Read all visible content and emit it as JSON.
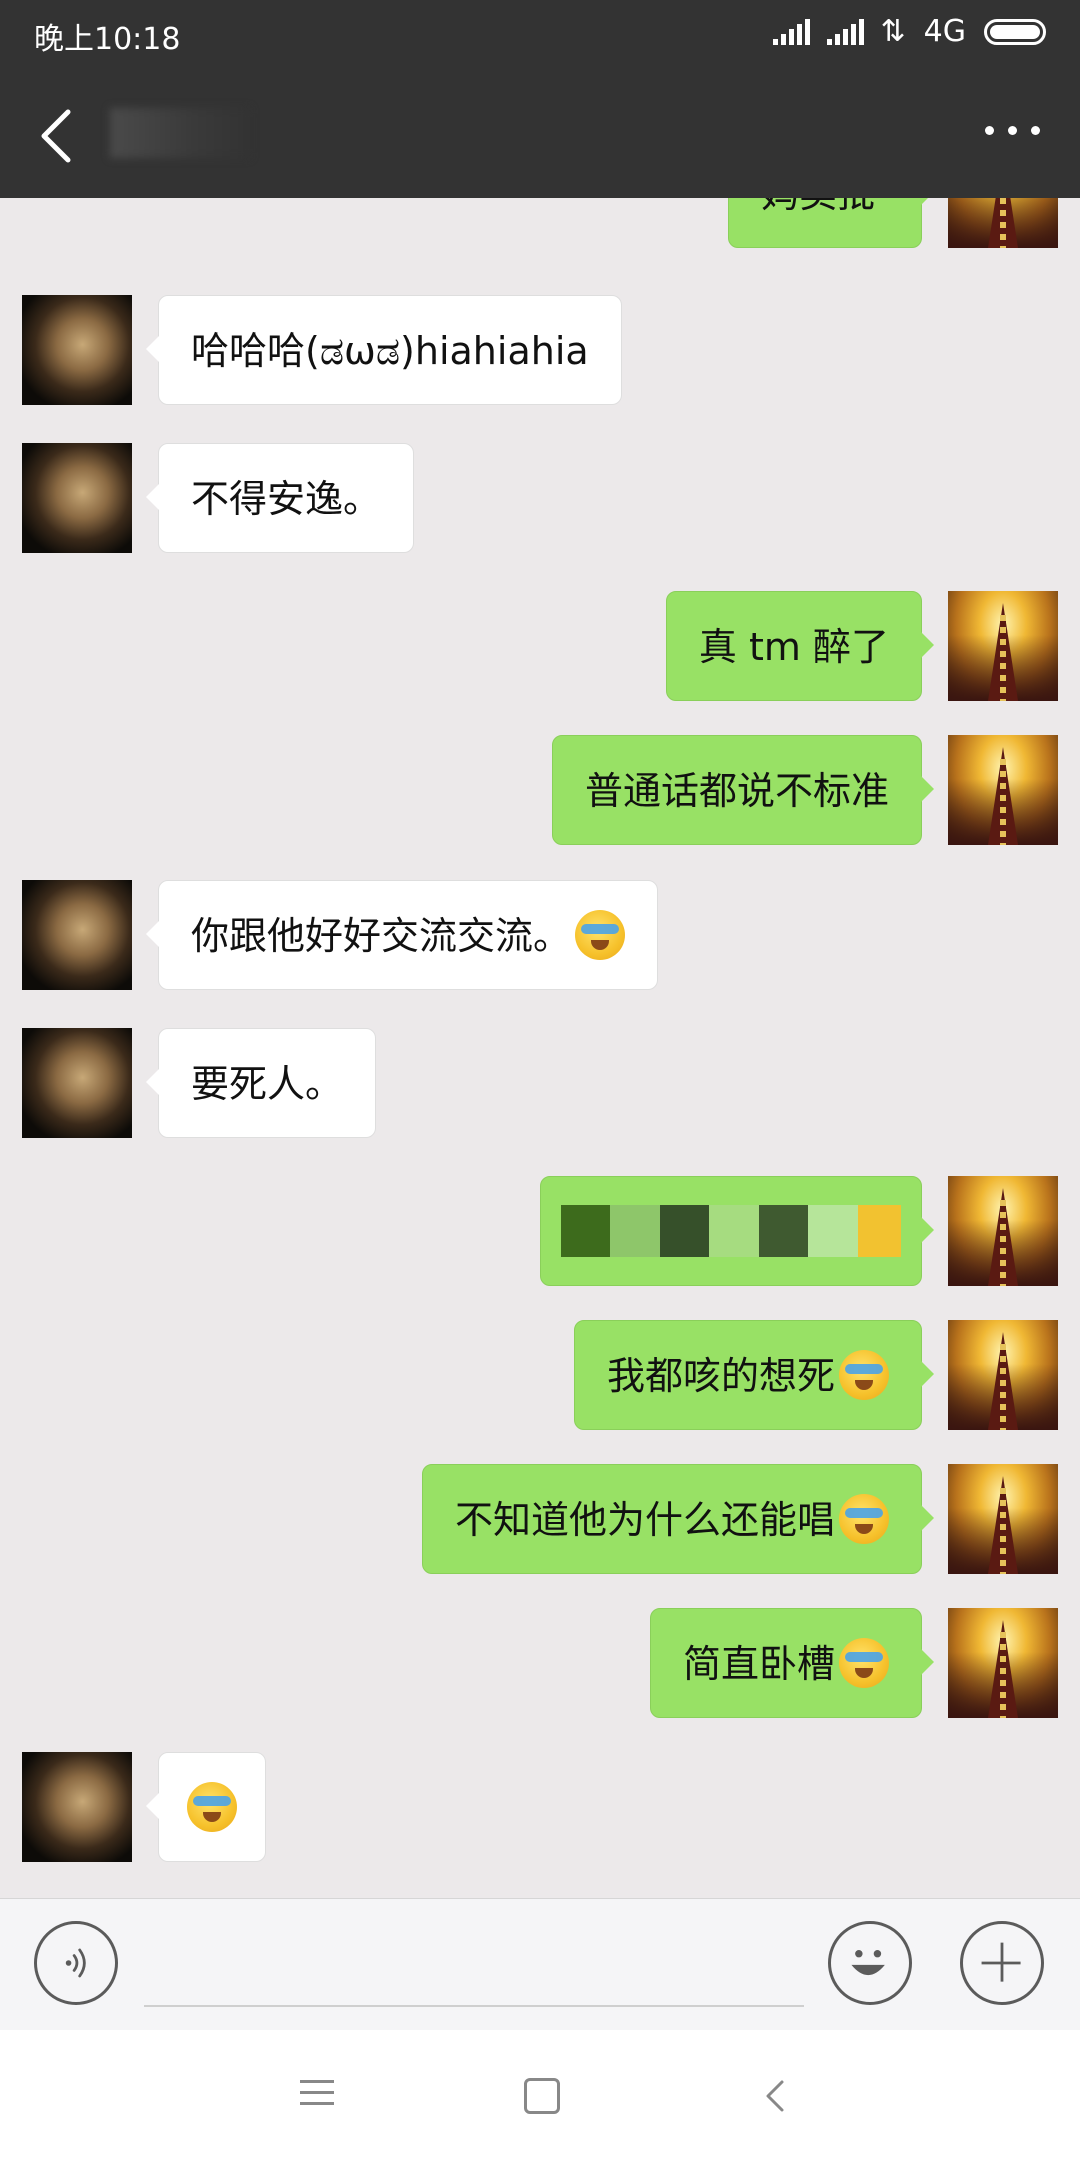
{
  "status_bar": {
    "time": "晚上10:18",
    "network": "4G"
  },
  "title_bar": {
    "back_icon": "chevron-left-icon",
    "more_icon": "more-dots-icon"
  },
  "messages": [
    {
      "side": "right",
      "text": "妈卖批",
      "partial": true
    },
    {
      "side": "left",
      "text": "哈哈哈(ಡωಡ)hiahiahia"
    },
    {
      "side": "left",
      "text": "不得安逸。"
    },
    {
      "side": "right",
      "text": "真 tm 醉了"
    },
    {
      "side": "right",
      "text": "普通话都说不标准"
    },
    {
      "side": "left",
      "text": "你跟他好好交流交流。",
      "emoji": "facepalm-cry-emoji"
    },
    {
      "side": "left",
      "text": "要死人。"
    },
    {
      "side": "right",
      "text": "",
      "pixelated": true
    },
    {
      "side": "right",
      "text": "我都咳的想死",
      "emoji": "facepalm-cry-emoji"
    },
    {
      "side": "right",
      "text": "不知道他为什么还能唱",
      "emoji": "facepalm-cry-emoji"
    },
    {
      "side": "right",
      "text": "简直卧槽",
      "emoji": "facepalm-cry-emoji"
    },
    {
      "side": "left",
      "text": "",
      "emoji": "facepalm-cry-emoji"
    }
  ],
  "input_bar": {
    "voice_icon": "voice-icon",
    "emoji_icon": "smiley-icon",
    "plus_icon": "plus-icon"
  },
  "nav_bar": {
    "menu_icon": "menu-icon",
    "home_icon": "home-square-icon",
    "back_icon": "back-triangle-icon"
  },
  "colors": {
    "header": "#333333",
    "chat_bg": "#ece9ea",
    "sent_bubble": "#98e165",
    "received_bubble": "#ffffff"
  }
}
